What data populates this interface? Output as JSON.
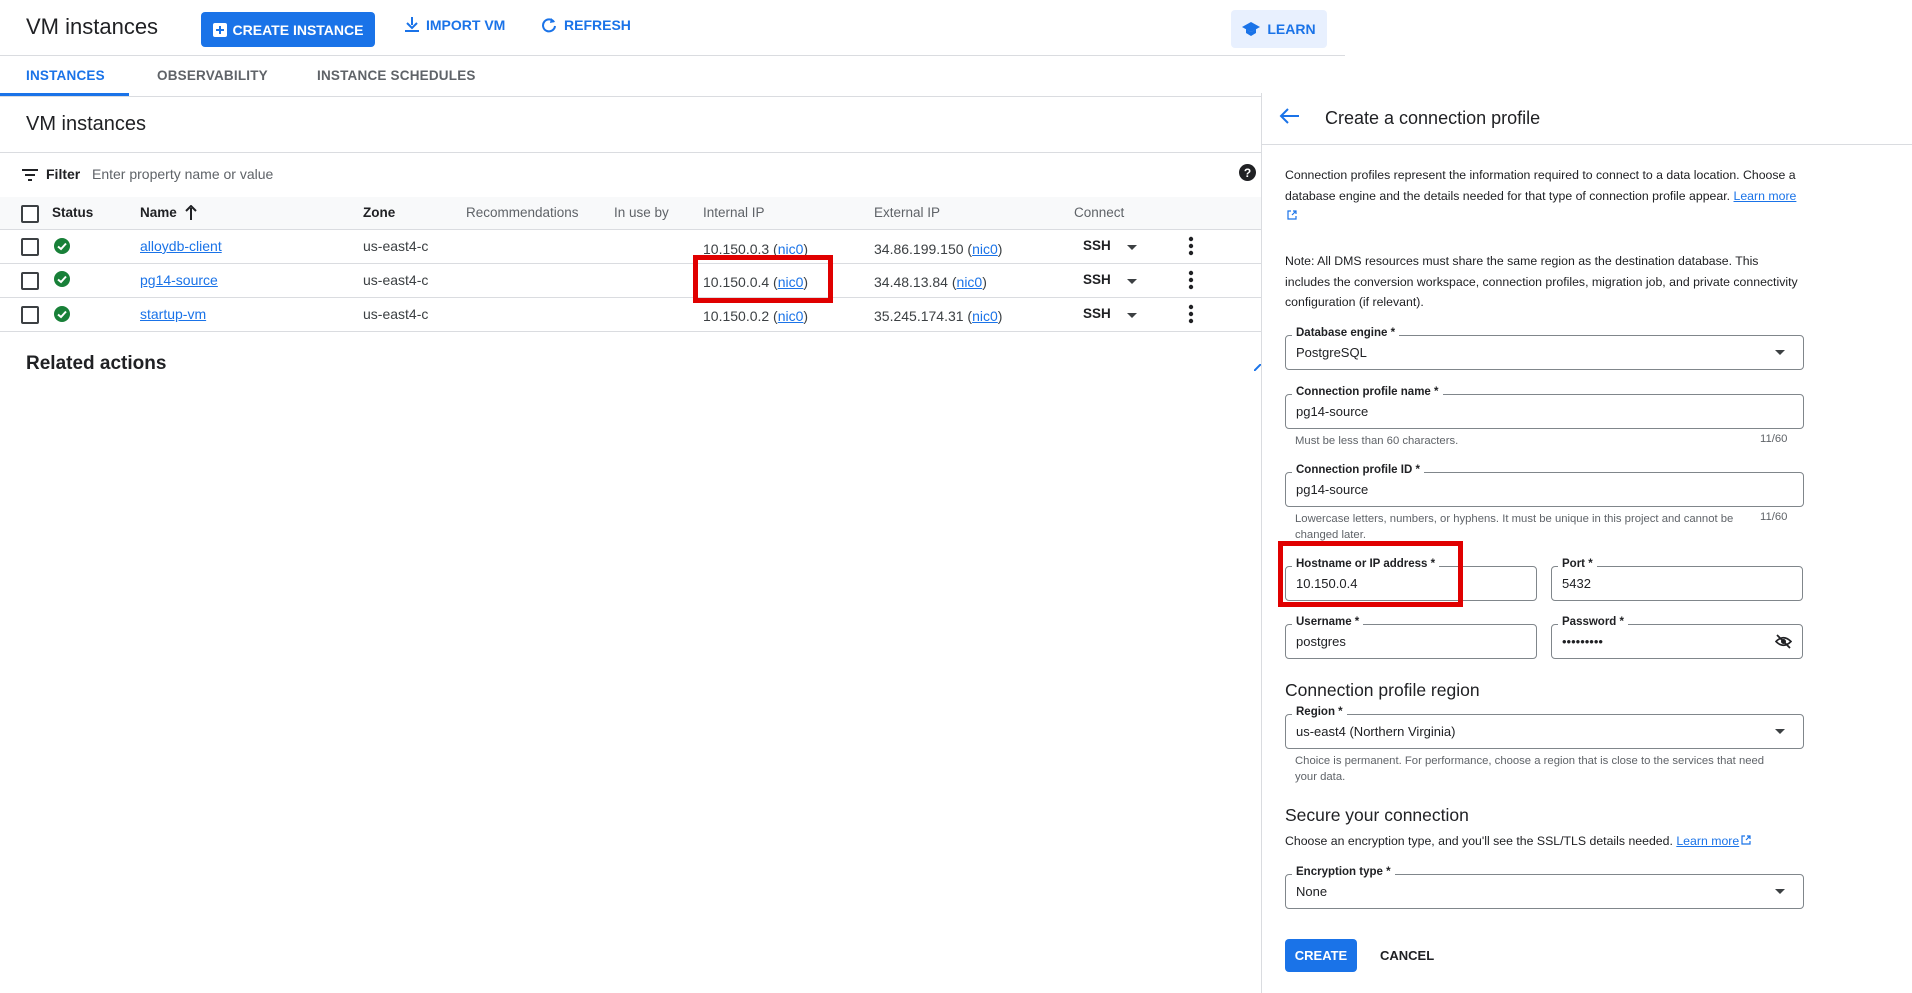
{
  "header": {
    "title": "VM instances",
    "create_instance": "CREATE INSTANCE",
    "import_vm": "IMPORT VM",
    "refresh": "REFRESH",
    "learn": "LEARN"
  },
  "tabs": [
    {
      "label": "INSTANCES",
      "active": true
    },
    {
      "label": "OBSERVABILITY",
      "active": false
    },
    {
      "label": "INSTANCE SCHEDULES",
      "active": false
    }
  ],
  "section_title": "VM instances",
  "filter": {
    "label": "Filter",
    "placeholder": "Enter property name or value"
  },
  "table": {
    "columns": [
      "Status",
      "Name",
      "Zone",
      "Recommendations",
      "In use by",
      "Internal IP",
      "External IP",
      "Connect"
    ],
    "rows": [
      {
        "name": "alloydb-client",
        "zone": "us-east4-c",
        "internal_ip": "10.150.0.3",
        "internal_nic": "nic0",
        "external_ip": "34.86.199.150",
        "external_nic": "nic0",
        "connect": "SSH"
      },
      {
        "name": "pg14-source",
        "zone": "us-east4-c",
        "internal_ip": "10.150.0.4",
        "internal_nic": "nic0",
        "external_ip": "34.48.13.84",
        "external_nic": "nic0",
        "connect": "SSH"
      },
      {
        "name": "startup-vm",
        "zone": "us-east4-c",
        "internal_ip": "10.150.0.2",
        "internal_nic": "nic0",
        "external_ip": "35.245.174.31",
        "external_nic": "nic0",
        "connect": "SSH"
      }
    ]
  },
  "related_actions": "Related actions",
  "panel": {
    "title": "Create a connection profile",
    "intro": "Connection profiles represent the information required to connect to a data location. Choose a database engine and the details needed for that type of connection profile appear.",
    "learn_more": "Learn more",
    "note": "Note: All DMS resources must share the same region as the destination database. This includes the conversion workspace, connection profiles, migration job, and private connectivity configuration (if relevant).",
    "engine": {
      "label": "Database engine *",
      "value": "PostgreSQL"
    },
    "profile_name": {
      "label": "Connection profile name *",
      "value": "pg14-source",
      "hint": "Must be less than 60 characters.",
      "count": "11/60"
    },
    "profile_id": {
      "label": "Connection profile ID *",
      "value": "pg14-source",
      "hint": "Lowercase letters, numbers, or hyphens. It must be unique in this project and cannot be changed later.",
      "count": "11/60"
    },
    "hostname": {
      "label": "Hostname or IP address *",
      "value": "10.150.0.4"
    },
    "port": {
      "label": "Port *",
      "value": "5432"
    },
    "username": {
      "label": "Username *",
      "value": "postgres"
    },
    "password": {
      "label": "Password *",
      "value": "•••••••••"
    },
    "region_heading": "Connection profile region",
    "region": {
      "label": "Region *",
      "value": "us-east4 (Northern Virginia)",
      "hint": "Choice is permanent. For performance, choose a region that is close to the services that need your data."
    },
    "secure_heading": "Secure your connection",
    "secure_text": "Choose an encryption type, and you'll see the SSL/TLS details needed.",
    "secure_learn_more": "Learn more",
    "encryption": {
      "label": "Encryption type *",
      "value": "None"
    },
    "create": "CREATE",
    "cancel": "CANCEL"
  },
  "colors": {
    "accent": "#1a73e8",
    "success": "#188038",
    "highlight": "#e00000"
  }
}
